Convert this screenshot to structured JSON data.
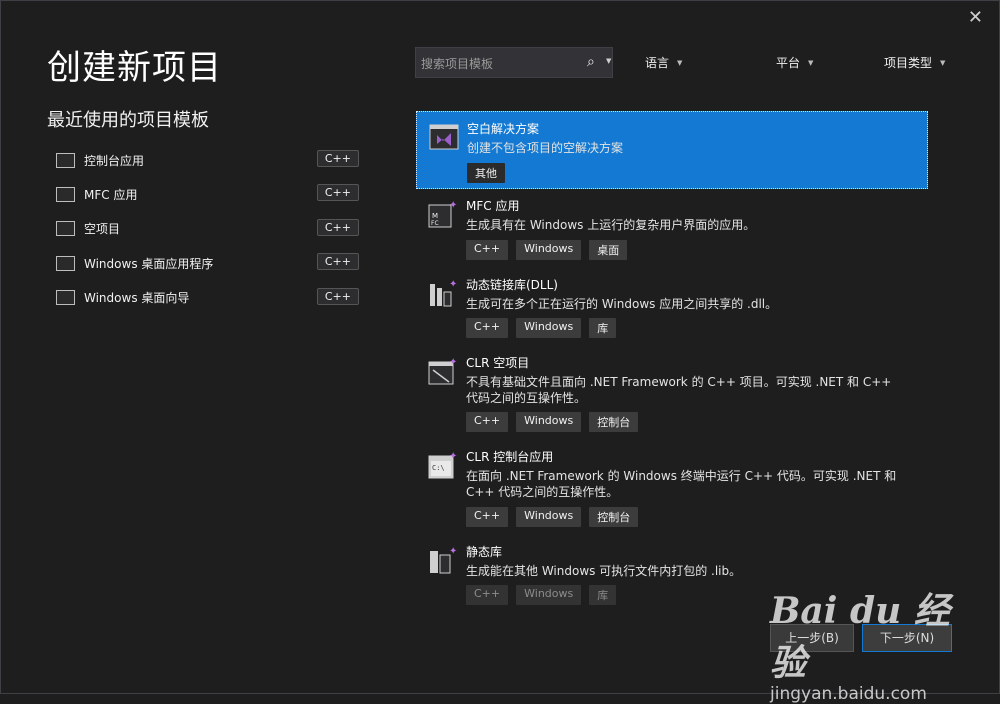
{
  "window": {
    "title": "创建新项目",
    "close_glyph": "✕"
  },
  "recent": {
    "heading": "最近使用的项目模板",
    "items": [
      {
        "label": "控制台应用",
        "tag": "C++"
      },
      {
        "label": "MFC 应用",
        "tag": "C++"
      },
      {
        "label": "空项目",
        "tag": "C++"
      },
      {
        "label": "Windows 桌面应用程序",
        "tag": "C++"
      },
      {
        "label": "Windows 桌面向导",
        "tag": "C++"
      }
    ]
  },
  "search": {
    "placeholder": "搜索项目模板",
    "icon": "search-icon"
  },
  "filters": {
    "language": "语言",
    "platform": "平台",
    "project_type": "项目类型"
  },
  "templates": [
    {
      "title": "空白解决方案",
      "desc": "创建不包含项目的空解决方案",
      "tags": [
        "其他"
      ],
      "selected": true
    },
    {
      "title": "MFC 应用",
      "desc": "生成具有在 Windows 上运行的复杂用户界面的应用。",
      "tags": [
        "C++",
        "Windows",
        "桌面"
      ]
    },
    {
      "title": "动态链接库(DLL)",
      "desc": "生成可在多个正在运行的 Windows 应用之间共享的 .dll。",
      "tags": [
        "C++",
        "Windows",
        "库"
      ]
    },
    {
      "title": "CLR 空项目",
      "desc": "不具有基础文件且面向 .NET Framework 的 C++ 项目。可实现 .NET 和 C++ 代码之间的互操作性。",
      "tags": [
        "C++",
        "Windows",
        "控制台"
      ]
    },
    {
      "title": "CLR 控制台应用",
      "desc": "在面向 .NET Framework 的 Windows 终端中运行 C++ 代码。可实现 .NET 和 C++ 代码之间的互操作性。",
      "tags": [
        "C++",
        "Windows",
        "控制台"
      ]
    },
    {
      "title": "静态库",
      "desc": "生成能在其他 Windows 可执行文件内打包的 .lib。",
      "tags": [
        "C++",
        "Windows",
        "库"
      ]
    }
  ],
  "buttons": {
    "back": "上一步(B)",
    "next": "下一步(N)"
  },
  "watermark": {
    "brand": "Bai du 经验",
    "url": "jingyan.baidu.com"
  },
  "colors": {
    "selected_bg": "#1479d2",
    "vs_purple": "#9b5fc9",
    "background": "#1e1e1e"
  }
}
